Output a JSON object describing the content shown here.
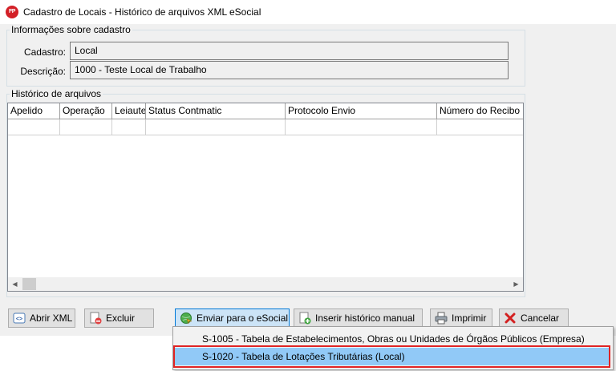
{
  "window": {
    "title": "Cadastro de Locais - Histórico de arquivos XML eSocial",
    "icon_text": "FP"
  },
  "info_group": {
    "legend": "Informações sobre cadastro",
    "cadastro_label": "Cadastro:",
    "cadastro_value": "Local",
    "descricao_label": "Descrição:",
    "descricao_value": "1000 - Teste Local de Trabalho"
  },
  "history_group": {
    "legend": "Histórico de arquivos",
    "columns": [
      "Apelido",
      "Operação",
      "Leiaute",
      "Status Contmatic",
      "Protocolo Envio",
      "Número do Recibo"
    ]
  },
  "buttons": {
    "abrir_xml": "Abrir XML",
    "excluir": "Excluir",
    "enviar": "Enviar para o eSocial",
    "inserir": "Inserir histórico manual",
    "imprimir": "Imprimir",
    "cancelar": "Cancelar"
  },
  "dropdown_menu": {
    "items": [
      "S-1005 - Tabela de Estabelecimentos, Obras ou Unidades de Órgãos Públicos (Empresa)",
      "S-1020 - Tabela de Lotações Tributárias (Local)"
    ]
  },
  "colors": {
    "highlight": "#91c9f7",
    "outline": "#e02424",
    "pressed_border": "#0078d7"
  }
}
